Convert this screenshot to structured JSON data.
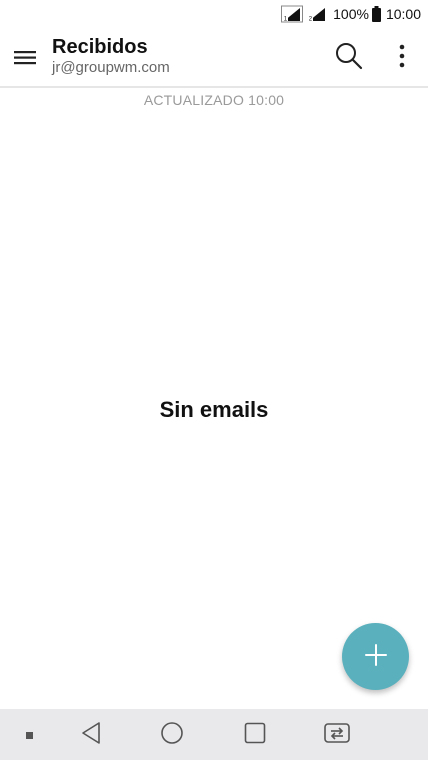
{
  "status_bar": {
    "battery_percent": "100%",
    "time": "10:00",
    "icons": [
      "sim-1-signal-icon",
      "sim-2-signal-icon",
      "battery-icon"
    ]
  },
  "app_bar": {
    "title": "Recibidos",
    "account": "jr@groupwm.com",
    "menu_icon": "hamburger-menu-icon",
    "search_icon": "search-icon",
    "more_icon": "more-vert-icon"
  },
  "inbox": {
    "updated_label": "ACTUALIZADO 10:00",
    "empty_message": "Sin emails"
  },
  "fab": {
    "icon": "plus-icon",
    "color": "#5ab0bd"
  },
  "nav_bar": {
    "items": [
      "notification-dot-icon",
      "back-icon",
      "home-icon",
      "recents-icon",
      "dual-window-icon"
    ],
    "background": "#e9e9ec"
  }
}
